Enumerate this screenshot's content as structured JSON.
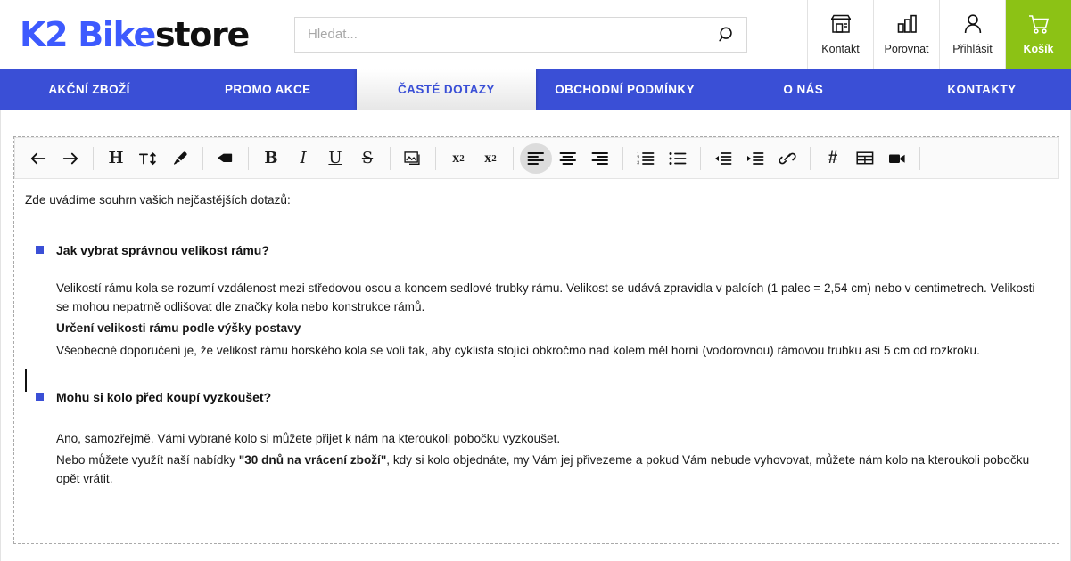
{
  "header": {
    "logo": {
      "primary": "K2 Bike",
      "secondary": "store",
      "primary_color": "#3d5afe",
      "secondary_color": "#101010"
    },
    "search": {
      "placeholder": "Hledat...",
      "value": "",
      "icon": "search-icon"
    },
    "actions": [
      {
        "label": "Kontakt",
        "icon": "store-icon"
      },
      {
        "label": "Porovnat",
        "icon": "bar-chart-icon"
      },
      {
        "label": "Přihlásit",
        "icon": "user-icon"
      },
      {
        "label": "Košík",
        "icon": "shopping-cart-icon",
        "accent": "#8cc215"
      }
    ]
  },
  "nav": {
    "accent": "#3a4fd6",
    "items": [
      {
        "label": "AKČNÍ ZBOŽÍ",
        "active": false
      },
      {
        "label": "PROMO AKCE",
        "active": false
      },
      {
        "label": "ČASTÉ DOTAZY",
        "active": true
      },
      {
        "label": "OBCHODNÍ PODMÍNKY",
        "active": false
      },
      {
        "label": "O NÁS",
        "active": false
      },
      {
        "label": "KONTAKTY",
        "active": false
      }
    ]
  },
  "page": {
    "clipped_title": "Časté dotazy"
  },
  "toolbar": {
    "groups": [
      [
        {
          "name": "undo-icon",
          "glyph": "←",
          "active": false
        },
        {
          "name": "redo-icon",
          "glyph": "→",
          "active": false
        }
      ],
      [
        {
          "name": "heading-icon",
          "glyph": "H",
          "active": false
        },
        {
          "name": "font-size-icon",
          "glyph": "T↕",
          "active": false
        },
        {
          "name": "text-color-brush-icon",
          "glyph": "brush",
          "active": false
        }
      ],
      [
        {
          "name": "clear-formatting-eraser-icon",
          "glyph": "eraser",
          "active": false
        }
      ],
      [
        {
          "name": "bold-icon",
          "glyph": "B",
          "active": false
        },
        {
          "name": "italic-icon",
          "glyph": "I",
          "active": false
        },
        {
          "name": "underline-icon",
          "glyph": "U",
          "active": false
        },
        {
          "name": "strikethrough-icon",
          "glyph": "S",
          "active": false
        }
      ],
      [
        {
          "name": "insert-image-icon",
          "glyph": "image",
          "active": false
        }
      ],
      [
        {
          "name": "superscript-icon",
          "glyph": "x²",
          "active": false
        },
        {
          "name": "subscript-icon",
          "glyph": "x₂",
          "active": false
        }
      ],
      [
        {
          "name": "align-left-icon",
          "glyph": "align-left",
          "active": true
        },
        {
          "name": "align-center-icon",
          "glyph": "align-center",
          "active": false
        },
        {
          "name": "align-right-icon",
          "glyph": "align-right",
          "active": false
        }
      ],
      [
        {
          "name": "ordered-list-icon",
          "glyph": "ol",
          "active": false
        },
        {
          "name": "unordered-list-icon",
          "glyph": "ul",
          "active": false
        }
      ],
      [
        {
          "name": "outdent-icon",
          "glyph": "outdent",
          "active": false
        },
        {
          "name": "indent-icon",
          "glyph": "indent",
          "active": false
        },
        {
          "name": "insert-link-icon",
          "glyph": "link",
          "active": false
        }
      ],
      [
        {
          "name": "anchor-hash-icon",
          "glyph": "#",
          "active": false
        },
        {
          "name": "insert-table-icon",
          "glyph": "table",
          "active": false
        },
        {
          "name": "insert-video-icon",
          "glyph": "video",
          "active": false
        }
      ]
    ]
  },
  "document": {
    "intro": "Zde uvádíme souhrn vašich nejčastějších dotazů:",
    "questions": [
      {
        "title": "Jak vybrat správnou velikost rámu?",
        "paragraph": "Velikostí rámu kola se rozumí vzdálenost mezi středovou osou a koncem sedlové trubky rámu. Velikost se udává zpravidla v palcích (1 palec = 2,54 cm) nebo v centimetrech. Velikosti se mohou nepatrně odlišovat dle značky kola nebo konstrukce rámů.",
        "subtitle": "Určení velikosti rámu podle výšky postavy",
        "subparagraph": "Všeobecné doporučení je, že velikost rámu horského kola se volí tak, aby cyklista stojící obkročmo nad kolem měl horní (vodorovnou) rámovou trubku asi 5 cm od rozkroku."
      },
      {
        "title": "Mohu si kolo před koupí vyzkoušet?",
        "paragraph": "Ano, samozřejmě. Vámi vybrané kolo si můžete přijet k nám na kteroukoli pobočku vyzkoušet.",
        "line2_before": "Nebo můžete využít naší nabídky ",
        "line2_bold": "\"30 dnů na vrácení zboží\"",
        "line2_after": ", kdy si kolo objednáte, my Vám jej přivezeme a pokud Vám nebude vyhovovat, můžete nám kolo na kteroukoli pobočku opět vrátit."
      }
    ]
  }
}
